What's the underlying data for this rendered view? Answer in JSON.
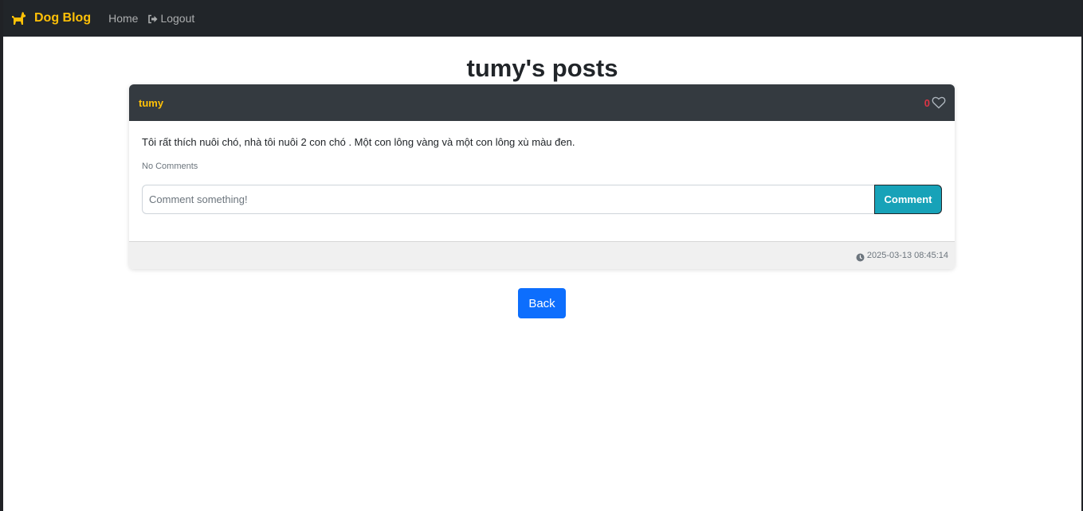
{
  "navbar": {
    "brand_icon": "dog-icon",
    "brand": "Dog Blog",
    "home": "Home",
    "logout_icon": "sign-out-icon",
    "logout": "Logout"
  },
  "page": {
    "title": "tumy's posts"
  },
  "post": {
    "author": "tumy",
    "likes": "0",
    "like_icon": "heart-outline-icon",
    "content": "Tôi rất thích nuôi chó, nhà tôi nuôi 2 con chó . Một con lông vàng và một con lông xù màu đen.",
    "comments_status": "No Comments",
    "comment_placeholder": "Comment something!",
    "comment_button": "Comment",
    "time_icon": "clock-icon",
    "timestamp": "2025-03-13 08:45:14"
  },
  "actions": {
    "back": "Back"
  },
  "colors": {
    "navbar_bg": "#212529",
    "brand": "#ffc107",
    "card_header_bg": "#343a40",
    "like_count": "#dc3545",
    "comment_button": "#17a2b8",
    "back_button": "#0d6efd"
  }
}
